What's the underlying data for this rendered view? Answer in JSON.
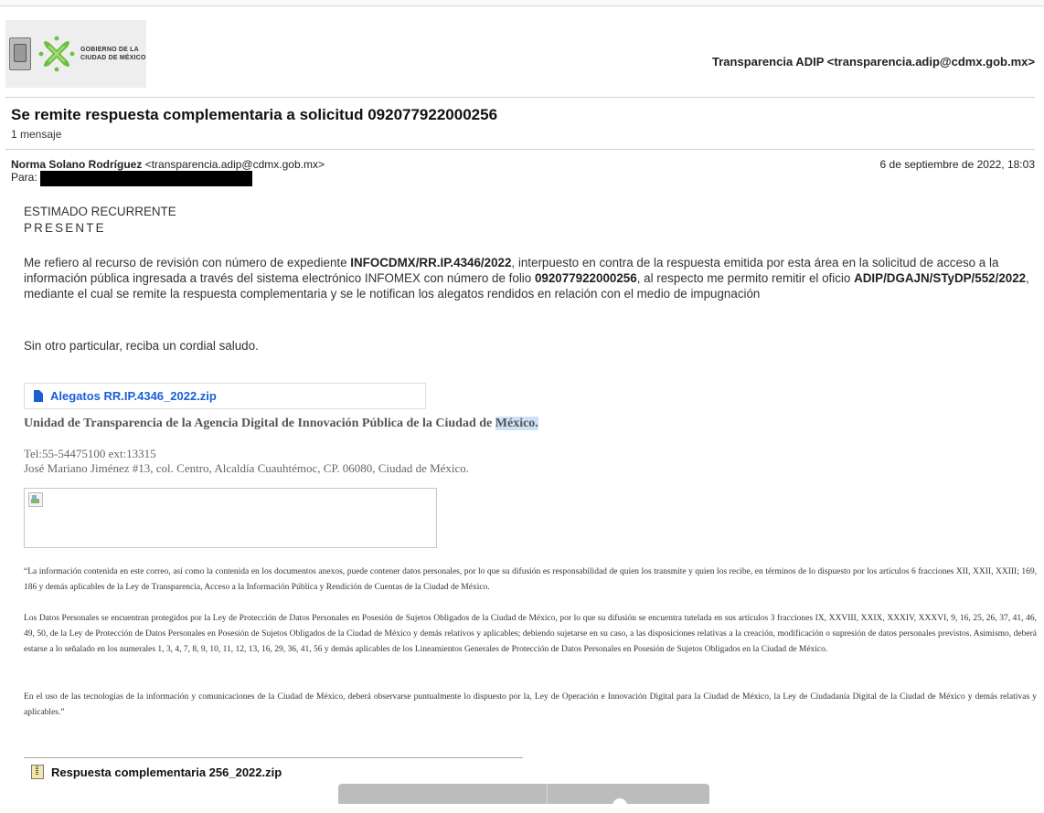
{
  "header": {
    "logo_text_line1": "GOBIERNO DE LA",
    "logo_text_line2": "CIUDAD DE MÉXICO",
    "from": "Transparencia ADIP <transparencia.adip@cdmx.gob.mx>"
  },
  "email": {
    "subject": "Se remite respuesta complementaria a solicitud 092077922000256",
    "message_count": "1 mensaje",
    "sender_name": "Norma Solano Rodríguez",
    "sender_email": "<transparencia.adip@cdmx.gob.mx>",
    "date": "6 de septiembre de 2022, 18:03",
    "to_label": "Para:"
  },
  "body": {
    "greeting": "ESTIMADO RECURRENTE",
    "presente": "PRESENTE",
    "p1_a": "Me refiero al recurso de revisión con número de expediente ",
    "p1_b": "INFOCDMX/RR.IP.4346/2022",
    "p1_c": ", interpuesto en contra de la respuesta emitida por esta área en la solicitud de acceso a la información pública ingresada a través del sistema electrónico INFOMEX con número de folio ",
    "p1_d": "092077922000256",
    "p1_e": ", al respecto me permito remitir el oficio ",
    "p1_f": "ADIP/DGAJN/STyDP/552/2022",
    "p1_g": ", mediante el cual se remite la respuesta complementaria y se le notifican los alegatos rendidos en relación con el medio de impugnación",
    "p2": "Sin otro particular, reciba un cordial saludo."
  },
  "attachment1": {
    "name": "Alegatos RR.IP.4346_2022.zip"
  },
  "signature": {
    "unit_a": "Unidad de Transparencia de la Agencia Digital de Innovación Pública de la Ciudad de ",
    "unit_b": "México.",
    "tel": "Tel:55-54475100 ext:13315",
    "address": "José Mariano Jiménez #13, col. Centro, Alcaldía Cuauhtémoc, CP. 06080, Ciudad de México."
  },
  "legal": {
    "l1": "“La información contenida en este correo, así como la contenida en los documentos anexos, puede contener datos personales, por lo que su difusión es responsabilidad de quien los transmite y quien los recibe, en términos de lo dispuesto por los artículos 6 fracciones XII, XXII, XXIII; 169, 186 y demás aplicables de la Ley de Transparencia, Acceso a la Información Pública y Rendición de Cuentas de la Ciudad de México.",
    "l2": "Los Datos Personales se encuentran protegidos por la Ley de Protección de Datos Personales en Posesión de Sujetos Obligados de la Ciudad de México, por lo que su difusión se encuentra tutelada en sus artículos 3 fracciones IX, XXVIII, XXIX, XXXIV, XXXVI, 9, 16, 25, 26, 37, 41, 46, 49, 50, de la Ley de Protección de Datos Personales en Posesión de Sujetos Obligados de la Ciudad de México y demás relativos y aplicables; debiendo sujetarse en su caso, a las disposiciones relativas a la creación, modificación o supresión de datos personales previstos. Asimismo, deberá estarse a lo señalado en los numerales 1, 3, 4, 7, 8, 9, 10, 11, 12, 13, 16, 29, 36, 41, 56 y demás aplicables de los Lineamientos Generales de Protección de Datos Personales en Posesión de Sujetos Obligados en la Ciudad de México.",
    "l3": "En el uso de las tecnologías de la información y comunicaciones de la Ciudad de México, deberá observarse puntualmente lo dispuesto por la, Ley de Operación e Innovación Digital para la Ciudad de México, la Ley de Ciudadanía Digital de la Ciudad de México y demás relativas y aplicables.”"
  },
  "attachment2": {
    "name": "Respuesta complementaria 256_2022.zip"
  },
  "colors": {
    "link": "#1a5fd6",
    "logo_green": "#6fbf3f",
    "highlight": "#cfe2f7"
  }
}
